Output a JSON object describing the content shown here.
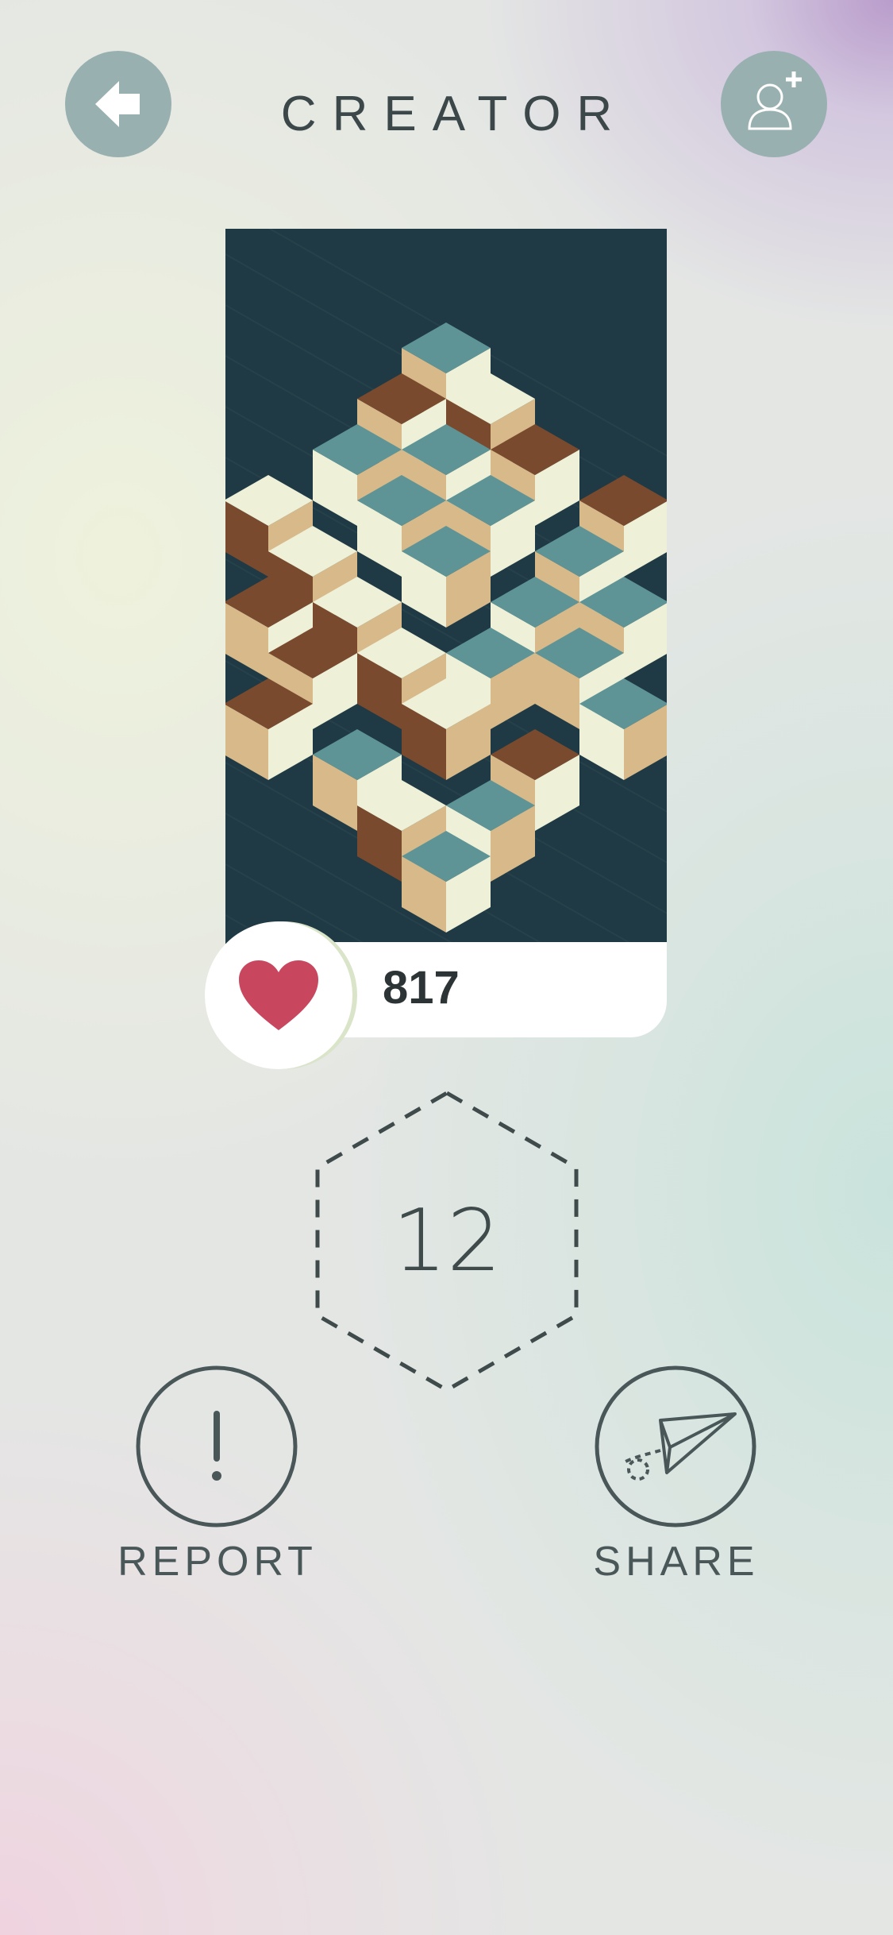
{
  "header": {
    "title": "CREATOR",
    "back_icon": "arrow-left-icon",
    "add_icon": "add-user-icon"
  },
  "artwork": {
    "palette": {
      "background": "#1f3a44",
      "teal": "#5f9497",
      "brown": "#7a4a2e",
      "tan": "#d7b98a",
      "cream": "#eef0d8"
    }
  },
  "likes": {
    "icon": "heart-icon",
    "count": "817",
    "heart_color": "#c8475f"
  },
  "level": {
    "number": "12",
    "icon": "hexagon-icon"
  },
  "actions": {
    "report_label": "REPORT",
    "report_icon": "exclamation-icon",
    "share_label": "SHARE",
    "share_icon": "paper-plane-icon"
  }
}
